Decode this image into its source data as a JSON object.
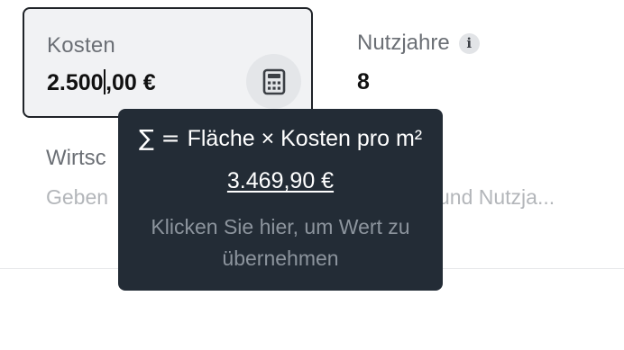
{
  "kosten": {
    "label": "Kosten",
    "value_before_caret": "2.500",
    "value_after_caret": ",00 €"
  },
  "nutzjahre": {
    "label": "Nutzjahre",
    "value": "8"
  },
  "wirtschaftlichkeit": {
    "label_visible": "Wirtsc",
    "hint_start": "Geben",
    "hint_end": "und Nutzja..."
  },
  "tooltip": {
    "sigma": "∑ =",
    "formula": "Fläche × Kosten pro m²",
    "result": "3.469,90 €",
    "hint": "Klicken Sie hier, um Wert zu übernehmen"
  },
  "icons": {
    "calculator": "calculator-icon",
    "info": "info-icon"
  }
}
